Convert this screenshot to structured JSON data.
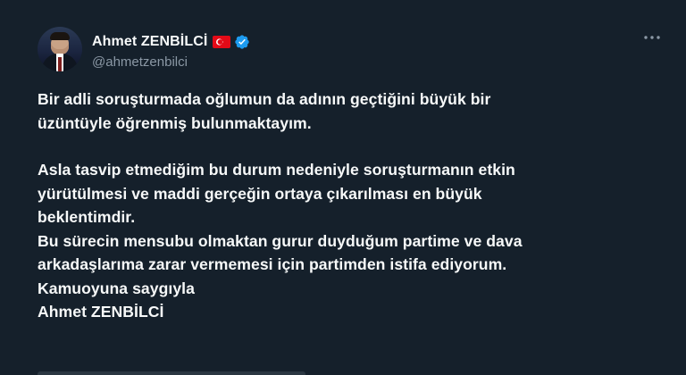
{
  "author": {
    "display_name": "Ahmet ZENBİLCİ",
    "handle": "@ahmetzenbilci",
    "flag_icon": "turkey-flag-icon",
    "verified_icon": "verified-badge-icon",
    "verified_color": "#1d9bf0"
  },
  "menu": {
    "icon": "more-options-icon"
  },
  "post": {
    "paragraph_1": "Bir adli soruşturmada oğlumun da adının geçtiğini büyük bir\nüzüntüyle öğrenmiş bulunmaktayım.",
    "paragraph_2": "Asla tasvip etmediğim bu durum nedeniyle soruşturmanın etkin\nyürütülmesi ve maddi gerçeğin ortaya çıkarılması en büyük\nbeklentimdir.",
    "paragraph_3": "Bu sürecin mensubu olmaktan gurur duyduğum partime ve dava\narkadaşlarıma zarar vermemesi için partimden istifa ediyorum.",
    "line_4": "Kamuoyuna saygıyla",
    "line_5": "Ahmet ZENBİLCİ"
  },
  "theme": {
    "background": "#15202b",
    "text": "#f7f9f9",
    "secondary_text": "#8b98a5"
  }
}
